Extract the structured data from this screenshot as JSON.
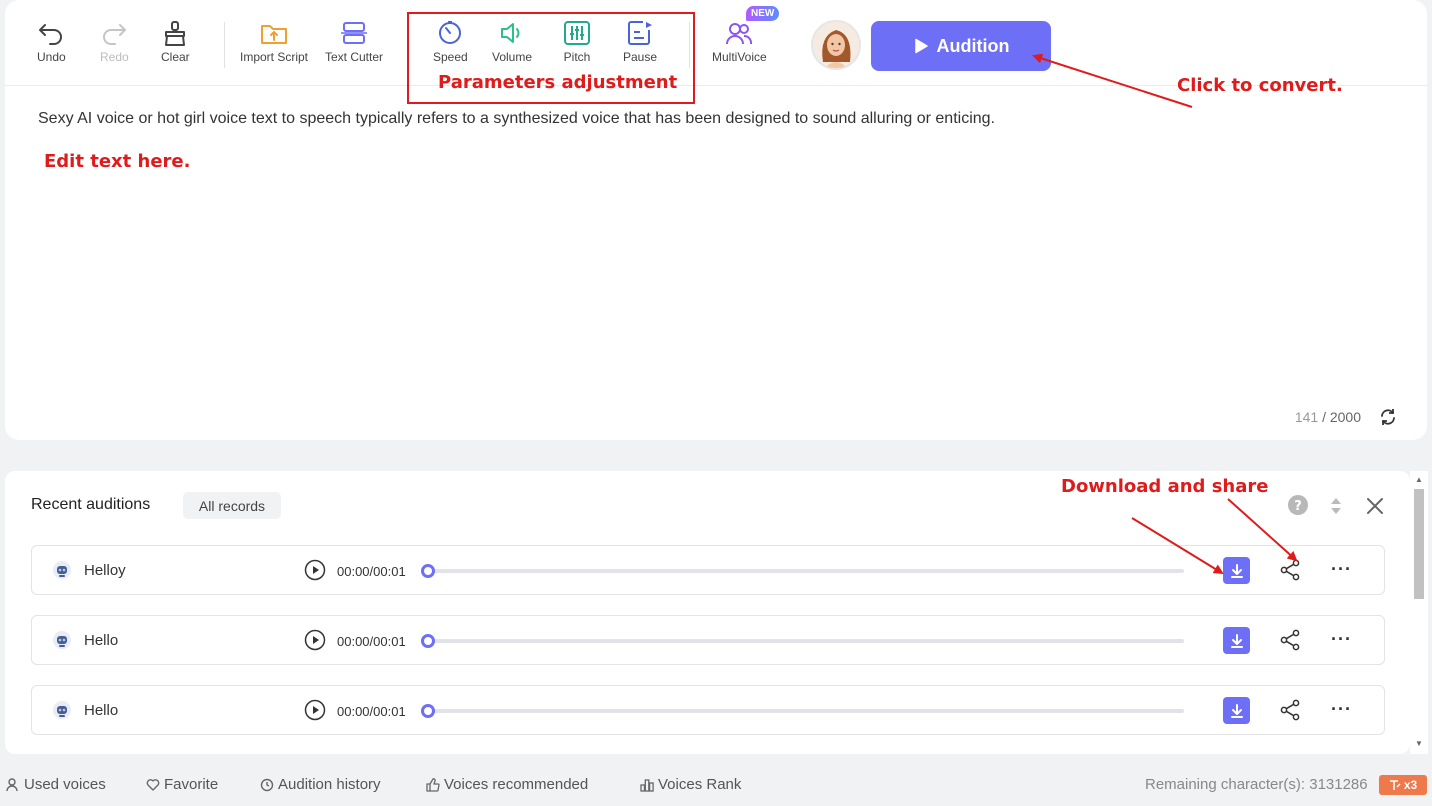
{
  "toolbar": {
    "undo": "Undo",
    "redo": "Redo",
    "clear": "Clear",
    "import_script": "Import Script",
    "text_cutter": "Text Cutter",
    "speed": "Speed",
    "volume": "Volume",
    "pitch": "Pitch",
    "pause": "Pause",
    "multivoice": "MultiVoice",
    "new_badge": "NEW",
    "audition": "Audition"
  },
  "annotations": {
    "parameters": "Parameters adjustment",
    "convert": "Click to convert.",
    "edit": "Edit text here.",
    "download_share": "Download and share"
  },
  "editor": {
    "text": "Sexy AI voice or hot girl voice text to speech typically refers to a synthesized voice that has been designed to sound alluring or enticing.",
    "count": "141",
    "max": "/ 2000"
  },
  "records": {
    "title": "Recent auditions",
    "all_records": "All records",
    "rows": [
      {
        "name": "Helloy",
        "time": "00:00/00:01"
      },
      {
        "name": "Hello",
        "time": "00:00/00:01"
      },
      {
        "name": "Hello",
        "time": "00:00/00:01"
      }
    ]
  },
  "footer": {
    "used_voices": "Used voices",
    "favorite": "Favorite",
    "audition_history": "Audition history",
    "voices_recommended": "Voices recommended",
    "voices_rank": "Voices Rank",
    "remaining": "Remaining character(s): 3131286",
    "multiplier": "x3"
  },
  "colors": {
    "accent": "#6d6ff6",
    "annotation": "#e01b1b",
    "badge_orange": "#ee7a4c"
  }
}
